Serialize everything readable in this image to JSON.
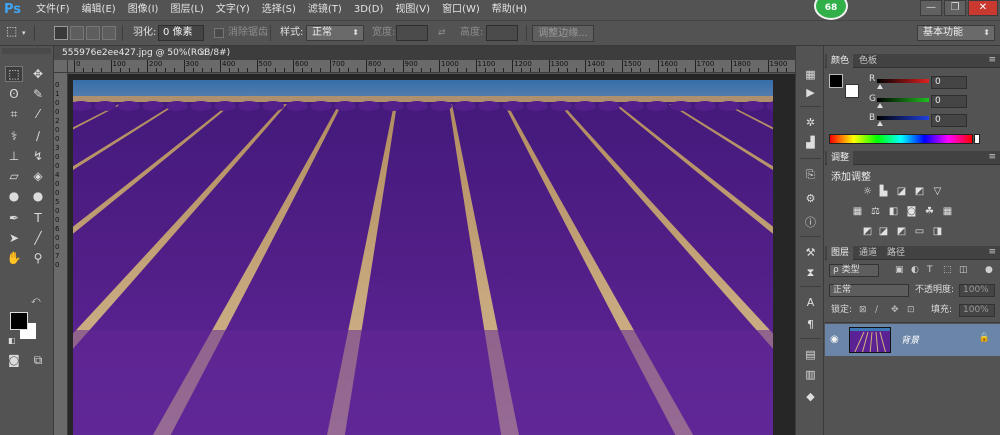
{
  "app": {
    "logo": "Ps",
    "badge": "68"
  },
  "menu": [
    "文件(F)",
    "编辑(E)",
    "图像(I)",
    "图层(L)",
    "文字(Y)",
    "选择(S)",
    "滤镜(T)",
    "3D(D)",
    "视图(V)",
    "窗口(W)",
    "帮助(H)"
  ],
  "window_controls": {
    "minimize": "—",
    "restore": "❐",
    "close": "✕"
  },
  "options": {
    "feather_label": "羽化:",
    "feather_value": "0 像素",
    "antialias_label": "消除锯齿",
    "style_label": "样式:",
    "style_value": "正常",
    "width_label": "宽度:",
    "height_label": "高度:",
    "refine_edge": "调整边缘...",
    "workspace": "基本功能"
  },
  "document": {
    "tab_title": "555976e2ee427.jpg @ 50%(RGB/8#)",
    "close": "×"
  },
  "ruler_top": [
    "0",
    "100",
    "200",
    "300",
    "400",
    "500",
    "600",
    "700",
    "800",
    "900",
    "1000",
    "1100",
    "1200",
    "1300",
    "1400",
    "1500",
    "1600",
    "1700",
    "1800",
    "1900"
  ],
  "ruler_left": [
    "0",
    "1",
    "0",
    "0",
    "2",
    "0",
    "0",
    "3",
    "0",
    "0",
    "4",
    "0",
    "0",
    "5",
    "0",
    "0",
    "6",
    "0",
    "0",
    "7",
    "0"
  ],
  "color_panel": {
    "tabs": [
      "颜色",
      "色板"
    ],
    "channels": [
      {
        "label": "R",
        "value": "0",
        "color": "#e02020"
      },
      {
        "label": "G",
        "value": "0",
        "color": "#20c020"
      },
      {
        "label": "B",
        "value": "0",
        "color": "#2040e0"
      }
    ]
  },
  "adjustments_panel": {
    "tab": "调整",
    "title": "添加调整",
    "row1_icons": [
      "brightness-icon",
      "levels-icon",
      "curves-icon",
      "exposure-icon",
      "vibrance-icon"
    ],
    "row2_icons": [
      "hue-icon",
      "balance-icon",
      "bw-icon",
      "photo-filter-icon",
      "channel-mixer-icon",
      "color-lookup-icon"
    ],
    "row3_icons": [
      "invert-icon",
      "posterize-icon",
      "threshold-icon",
      "gradient-map-icon",
      "selective-color-icon"
    ]
  },
  "layers_panel": {
    "tabs": [
      "图层",
      "通道",
      "路径"
    ],
    "filter_label": "ρ 类型",
    "blend_mode": "正常",
    "opacity_label": "不透明度:",
    "opacity_value": "100%",
    "lock_label": "锁定:",
    "fill_label": "填充:",
    "fill_value": "100%",
    "layer_name": "背景",
    "lock_glyph": "🔒"
  },
  "colors": {
    "lavender": "#5a1f8f",
    "sky": "#2e6fb0",
    "soil": "#d8b27a"
  }
}
